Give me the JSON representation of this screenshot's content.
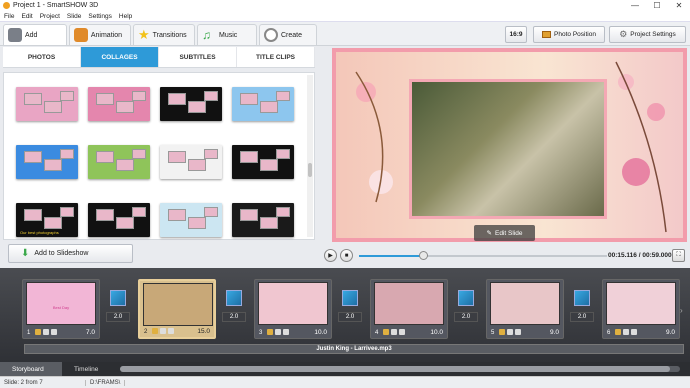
{
  "window": {
    "title": "Project 1 - SmartSHOW 3D",
    "min": "—",
    "max": "☐",
    "close": "✕"
  },
  "menu": [
    "File",
    "Edit",
    "Project",
    "Slide",
    "Settings",
    "Help"
  ],
  "main_tabs": [
    {
      "label": "Add",
      "icon": "add-icon",
      "color": "#7a7f88"
    },
    {
      "label": "Animation",
      "icon": "animation-icon",
      "color": "#e08a2a"
    },
    {
      "label": "Transitions",
      "icon": "star-icon",
      "color": "#f2c21a"
    },
    {
      "label": "Music",
      "icon": "music-icon",
      "color": "#3aa84a"
    },
    {
      "label": "Create",
      "icon": "film-reel-icon",
      "color": "#888888"
    }
  ],
  "toolbar": {
    "aspect": "16:9",
    "photo_position": "Photo Position",
    "project_settings": "Project Settings"
  },
  "sub_tabs": [
    "PHOTOS",
    "COLLAGES",
    "SUBTITLES",
    "TITLE CLIPS"
  ],
  "collages": [
    {
      "bg": "#e9a5c4"
    },
    {
      "bg": "#e486ad"
    },
    {
      "bg": "#111111"
    },
    {
      "bg": "#8dc6ee"
    },
    {
      "bg": "#3b8be0"
    },
    {
      "bg": "#8fc45a"
    },
    {
      "bg": "#f2f2f2"
    },
    {
      "bg": "#111111"
    },
    {
      "bg": "#111111",
      "text": "Our best photographs"
    },
    {
      "bg": "#111111"
    },
    {
      "bg": "#cce6f2"
    },
    {
      "bg": "#1a1a1a"
    }
  ],
  "add_to_slideshow": "Add to Slideshow",
  "edit_slide": "Edit Slide",
  "player": {
    "timecode": "00:15.116 / 00:59.000",
    "progress": 0.26
  },
  "slides": [
    {
      "num": "1",
      "duration": "7.0",
      "bg": "#f2b6d6",
      "caption": "Best Day",
      "selected": false
    },
    {
      "num": "2",
      "duration": "15.0",
      "bg": "#c8a878",
      "selected": true
    },
    {
      "num": "3",
      "duration": "10.0",
      "bg": "#f0c6d0",
      "selected": false
    },
    {
      "num": "4",
      "duration": "10.0",
      "bg": "#d8a8b0",
      "selected": false
    },
    {
      "num": "5",
      "duration": "9.0",
      "bg": "#e8c6c8",
      "selected": false
    },
    {
      "num": "6",
      "duration": "9.0",
      "bg": "#f0d0d8",
      "selected": false
    }
  ],
  "transitions": [
    "2.0",
    "2.0",
    "2.0",
    "2.0",
    "2.0"
  ],
  "audio_track": "Justin King - Larrivee.mp3",
  "bottom_tabs": [
    "Storyboard",
    "Timeline"
  ],
  "status": {
    "slide": "Slide: 2 from 7",
    "path": "D:\\FRAMS\\"
  }
}
